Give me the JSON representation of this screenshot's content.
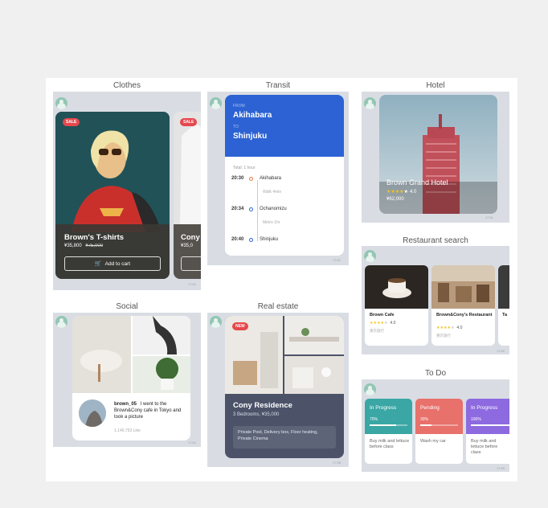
{
  "sections": {
    "clothes": "Clothes",
    "transit": "Transit",
    "hotel": "Hotel",
    "restaurant": "Restaurant search",
    "social": "Social",
    "realestate": "Real estate",
    "todo": "To Do"
  },
  "clothes": {
    "badge": "SALE",
    "badge2": "SALE",
    "title": "Brown's T-shirts",
    "price": "¥35,800",
    "old_price": "¥75,000",
    "cart": "Add to cart",
    "peek_title": "Cony",
    "peek_price": "¥35,0",
    "time": "17:51"
  },
  "transit": {
    "from_label": "FROM",
    "from": "Akihabara",
    "to_label": "TO",
    "to": "Shinjuku",
    "total": "Total: 1 hour",
    "stops": [
      {
        "time": "20:30",
        "name": "Akihabara"
      },
      {
        "time": "20:34",
        "name": "Ochanomizu"
      },
      {
        "time": "20:40",
        "name": "Shinjuku"
      }
    ],
    "notes": [
      "Walk 4min",
      "Metro 1hr"
    ],
    "time": "17:51"
  },
  "hotel": {
    "name": "Brown Grand Hotel",
    "rating": "4.0",
    "price": "¥62,000",
    "time": "17:51"
  },
  "restaurants": {
    "items": [
      {
        "name": "Brown Cafe",
        "rating": "4.0",
        "sub": "東京旅行"
      },
      {
        "name": "Brown&Cony's Restaurant",
        "rating": "4.0",
        "sub": "東京旅行"
      },
      {
        "name": "Ta",
        "rating": "",
        "sub": ""
      }
    ],
    "time": "17:50"
  },
  "social": {
    "user": "brown_05",
    "text": "I went to the Brown&Cony cafe in Tokyo and took a picture",
    "likes": "1,140,753 Like",
    "time": "17:51"
  },
  "realestate": {
    "badge": "NEW",
    "title": "Cony Residence",
    "sub": "3 Bedrooms, ¥35,000",
    "desc": "Private Pool, Delivery box, Floor heating, Private Cinema",
    "time": "17:58"
  },
  "todo": {
    "items": [
      {
        "status": "In Progress",
        "pct": "70%",
        "progress": 0.7,
        "text": "Buy milk and lettuce before class",
        "color": "#3aa7a5"
      },
      {
        "status": "Pending",
        "pct": "30%",
        "progress": 0.3,
        "text": "Wash my car",
        "color": "#e8716b"
      },
      {
        "status": "In Progress",
        "pct": "100%",
        "progress": 1.0,
        "text": "Buy milk and lettuce before class",
        "color": "#8d6ae0"
      }
    ],
    "time": "17:59"
  }
}
